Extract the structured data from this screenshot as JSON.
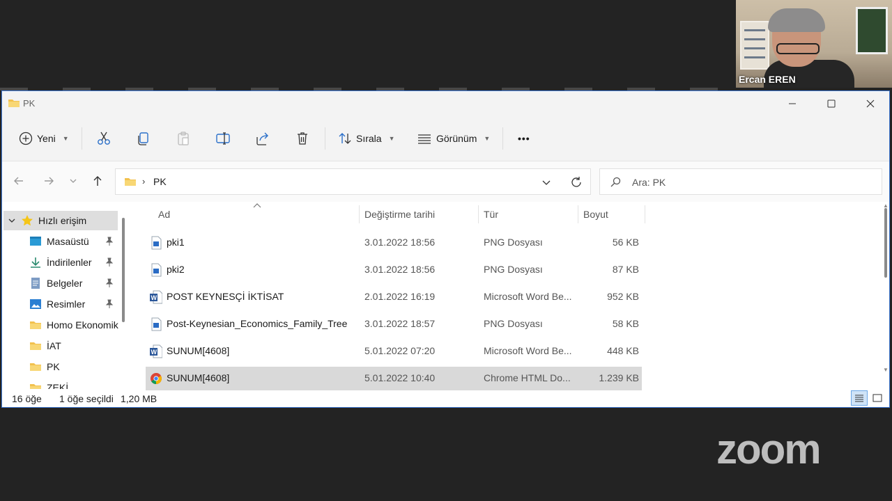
{
  "participant": {
    "name": "Ercan EREN"
  },
  "window": {
    "title": "PK",
    "controls": {
      "minimize": "—",
      "maximize": "☐",
      "close": "✕"
    }
  },
  "toolbar": {
    "new_label": "Yeni",
    "sort_label": "Sırala",
    "view_label": "Görünüm",
    "more_label": "•••"
  },
  "address": {
    "separator": "›",
    "path": "PK"
  },
  "search": {
    "placeholder": "Ara: PK"
  },
  "sidebar": {
    "items": [
      {
        "label": "Hızlı erişim",
        "icon": "star-icon"
      },
      {
        "label": "Masaüstü",
        "icon": "desktop-icon",
        "pinned": true
      },
      {
        "label": "İndirilenler",
        "icon": "download-icon",
        "pinned": true
      },
      {
        "label": "Belgeler",
        "icon": "documents-icon",
        "pinned": true
      },
      {
        "label": "Resimler",
        "icon": "pictures-icon",
        "pinned": true
      },
      {
        "label": "Homo Ekonomik",
        "icon": "folder-icon"
      },
      {
        "label": "İAT",
        "icon": "folder-icon"
      },
      {
        "label": "PK",
        "icon": "folder-icon"
      },
      {
        "label": "ZEKİ",
        "icon": "folder-icon"
      }
    ]
  },
  "columns": {
    "name": "Ad",
    "date": "Değiştirme tarihi",
    "type": "Tür",
    "size": "Boyut"
  },
  "files": [
    {
      "name": "pki1",
      "date": "3.01.2022 18:56",
      "type": "PNG Dosyası",
      "size": "56 KB",
      "icon": "png-file-icon"
    },
    {
      "name": "pki2",
      "date": "3.01.2022 18:56",
      "type": "PNG Dosyası",
      "size": "87 KB",
      "icon": "png-file-icon"
    },
    {
      "name": "POST KEYNESÇİ İKTİSAT",
      "date": "2.01.2022 16:19",
      "type": "Microsoft Word Be...",
      "size": "952 KB",
      "icon": "word-file-icon"
    },
    {
      "name": "Post-Keynesian_Economics_Family_Tree",
      "date": "3.01.2022 18:57",
      "type": "PNG Dosyası",
      "size": "58 KB",
      "icon": "png-file-icon"
    },
    {
      "name": "SUNUM[4608]",
      "date": "5.01.2022 07:20",
      "type": "Microsoft Word Be...",
      "size": "448 KB",
      "icon": "word-file-icon"
    },
    {
      "name": "SUNUM[4608]",
      "date": "5.01.2022 10:40",
      "type": "Chrome HTML Do...",
      "size": "1.239 KB",
      "icon": "chrome-file-icon",
      "selected": true
    }
  ],
  "status": {
    "count": "16 öğe",
    "selection": "1 öğe seçildi",
    "size": "1,20 MB"
  },
  "branding": {
    "zoom": "zoom"
  },
  "colors": {
    "accent": "#3f7ad6",
    "selected_row": "#d9d9d9",
    "folder": "#f2c14e",
    "background": "#232323"
  }
}
